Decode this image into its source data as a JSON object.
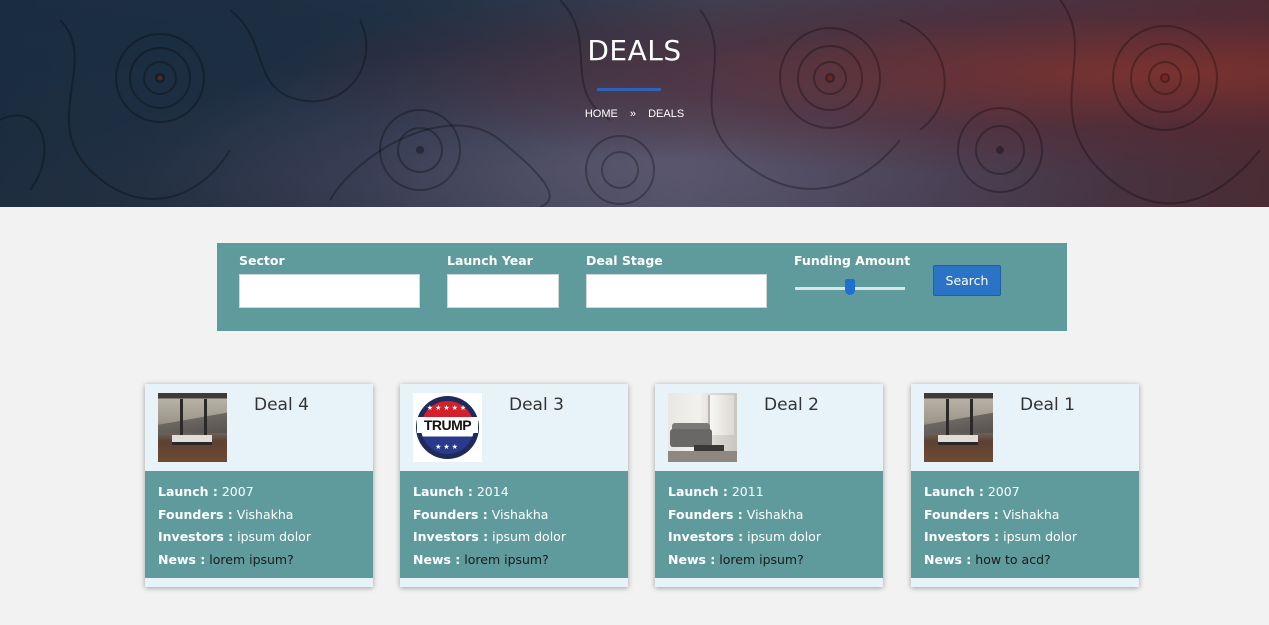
{
  "hero": {
    "title": "DEALS",
    "breadcrumb": {
      "home": "HOME",
      "separator": "»",
      "current": "DEALS"
    }
  },
  "filters": {
    "sector_label": "Sector",
    "launch_year_label": "Launch Year",
    "deal_stage_label": "Deal Stage",
    "funding_amount_label": "Funding Amount",
    "funding_amount_value": 0.5,
    "search_label": "Search",
    "sector_value": "",
    "launch_year_value": "",
    "deal_stage_value": ""
  },
  "card_labels": {
    "launch": "Launch :",
    "founders": "Founders :",
    "investors": "Investors :",
    "news": "News :"
  },
  "deals": [
    {
      "title": "Deal 4",
      "image": "bedroom-mountain-view-photo",
      "launch": "2007",
      "founders": "Vishakha",
      "investors": "ipsum dolor",
      "news": "lorem ipsum?"
    },
    {
      "title": "Deal 3",
      "image": "trump-campaign-button",
      "image_text": "TRUMP",
      "launch": "2014",
      "founders": "Vishakha",
      "investors": "ipsum dolor",
      "news": "lorem ipsum?"
    },
    {
      "title": "Deal 2",
      "image": "living-room-sofa-photo",
      "launch": "2011",
      "founders": "Vishakha",
      "investors": "ipsum dolor",
      "news": "lorem ipsum?"
    },
    {
      "title": "Deal 1",
      "image": "bedroom-mountain-view-photo",
      "launch": "2007",
      "founders": "Vishakha",
      "investors": "ipsum dolor",
      "news": "how to acd?"
    }
  ],
  "colors": {
    "teal": "#5f9b9d",
    "card_header": "#e8f3f9",
    "accent_blue": "#2a73c5",
    "page_bg": "#f2f2f2"
  }
}
